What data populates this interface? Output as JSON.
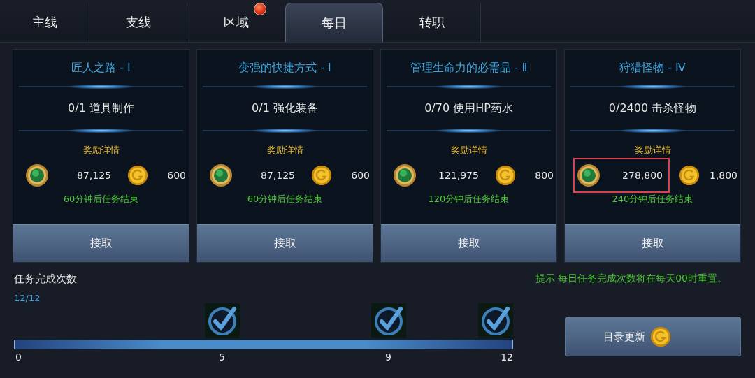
{
  "tabs": [
    {
      "label": "主线",
      "selected": false,
      "badge": false
    },
    {
      "label": "支线",
      "selected": false,
      "badge": false
    },
    {
      "label": "区域",
      "selected": false,
      "badge": true
    },
    {
      "label": "每日",
      "selected": true,
      "badge": false
    },
    {
      "label": "转职",
      "selected": false,
      "badge": false
    }
  ],
  "quests": [
    {
      "title": "匠人之路 - Ⅰ",
      "progress": "0/1 道具制作",
      "reward_label": "奖励详情",
      "exp": "87,125",
      "gold": "600",
      "exp_highlighted": false,
      "timer": "60分钟后任务结束",
      "button": "接取"
    },
    {
      "title": "变强的快捷方式 - Ⅰ",
      "progress": "0/1 强化装备",
      "reward_label": "奖励详情",
      "exp": "87,125",
      "gold": "600",
      "exp_highlighted": false,
      "timer": "60分钟后任务结束",
      "button": "接取"
    },
    {
      "title": "管理生命力的必需品 - Ⅱ",
      "progress": "0/70 使用HP药水",
      "reward_label": "奖励详情",
      "exp": "121,975",
      "gold": "800",
      "exp_highlighted": false,
      "timer": "120分钟后任务结束",
      "button": "接取"
    },
    {
      "title": "狩猎怪物 - Ⅳ",
      "progress": "0/2400 击杀怪物",
      "reward_label": "奖励详情",
      "exp": "278,800",
      "gold": "1,800",
      "exp_highlighted": true,
      "timer": "240分钟后任务结束",
      "button": "接取"
    }
  ],
  "completion": {
    "label": "任务完成次数",
    "count": "12/12",
    "level": 1,
    "ticks": [
      {
        "label": "0",
        "milestone": false
      },
      {
        "label": "5",
        "milestone": true
      },
      {
        "label": "9",
        "milestone": true
      },
      {
        "label": "12",
        "milestone": true
      }
    ]
  },
  "hint": "提示 每日任务完成次数将在每天00时重置。",
  "refresh_button": {
    "label": "目录更新"
  }
}
